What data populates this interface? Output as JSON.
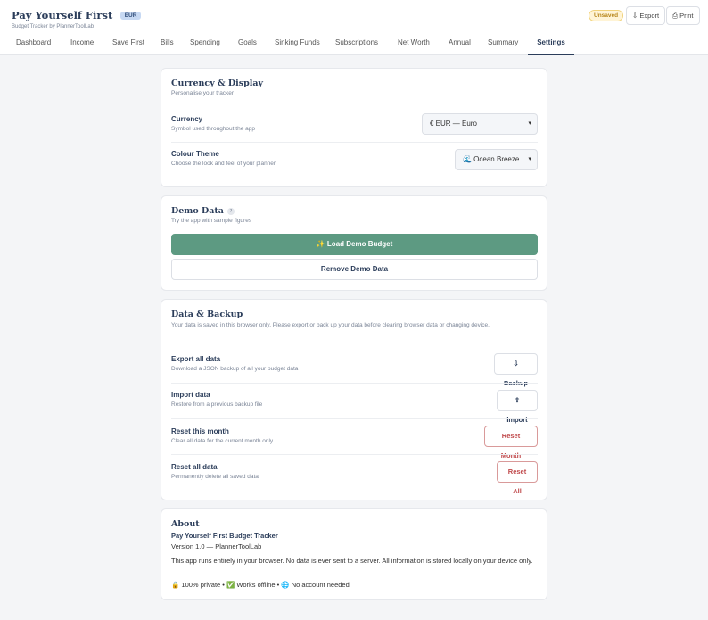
{
  "header": {
    "title": "Pay Yourself First",
    "currency_badge": "EUR",
    "subtitle": "Budget Tracker by PlannerToolLab",
    "status": "Unsaved",
    "export_label": "Export",
    "print_label": "Print",
    "export_icon": "⇩",
    "print_icon": "⎙"
  },
  "nav": {
    "tabs": [
      {
        "label": "Dashboard"
      },
      {
        "label": "Income"
      },
      {
        "label": "Save First"
      },
      {
        "label": "Bills"
      },
      {
        "label": "Spending"
      },
      {
        "label": "Goals"
      },
      {
        "label": "Sinking Funds"
      },
      {
        "label": "Subscriptions"
      },
      {
        "label": "Net Worth"
      },
      {
        "label": "Annual"
      },
      {
        "label": "Summary"
      },
      {
        "label": "Settings"
      }
    ],
    "active": "Settings"
  },
  "currency_display": {
    "title": "Currency & Display",
    "subtitle": "Personalise your tracker",
    "currency": {
      "label": "Currency",
      "description": "Symbol used throughout the app",
      "value": "€ EUR — Euro"
    },
    "theme": {
      "label": "Colour Theme",
      "description": "Choose the look and feel of your planner",
      "value": "🌊 Ocean Breeze"
    }
  },
  "demo": {
    "title": "Demo Data",
    "help": "?",
    "subtitle": "Try the app with sample figures",
    "load_label": "✨ Load Demo Budget",
    "remove_label": "Remove Demo Data"
  },
  "backup": {
    "title": "Data & Backup",
    "subtitle": "Your data is saved in this browser only. Please export or back up your data before clearing browser data or changing device.",
    "export": {
      "label": "Export all data",
      "description": "Download a JSON backup of all your budget data",
      "button": "⇩ Backup"
    },
    "import": {
      "label": "Import data",
      "description": "Restore from a previous backup file",
      "button": "⇧ Import"
    },
    "reset_month": {
      "label": "Reset this month",
      "description": "Clear all data for the current month only",
      "button": "Reset Month"
    },
    "reset_all": {
      "label": "Reset all data",
      "description": "Permanently delete all saved data",
      "button": "Reset All"
    }
  },
  "about": {
    "title": "About",
    "product": "Pay Yourself First Budget Tracker",
    "version": "Version 1.0 — PlannerToolLab",
    "description": "This app runs entirely in your browser. No data is ever sent to a server. All information is stored locally on your device only.",
    "features": "🔒 100% private • ✅ Works offline • 🌐 No account needed"
  },
  "colors": {
    "accent": "#5d9a82",
    "brand": "#2b3d5a",
    "danger": "#c0494b"
  }
}
